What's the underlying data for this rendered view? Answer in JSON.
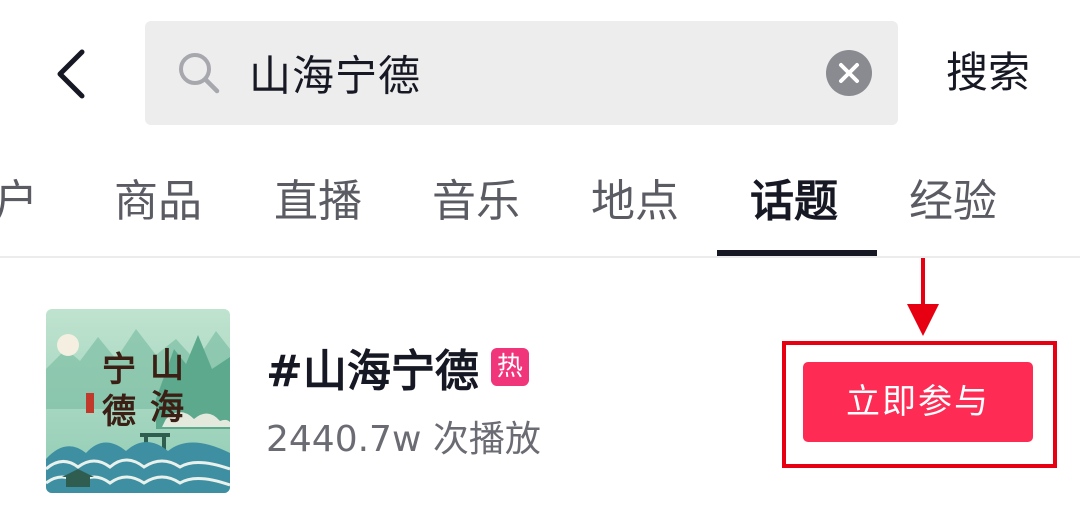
{
  "header": {
    "back_icon": "chevron-left-icon",
    "search": {
      "icon": "search-icon",
      "value": "山海宁德",
      "clear_icon": "clear-circle-icon"
    },
    "submit_label": "搜索"
  },
  "tabs": {
    "items": [
      {
        "label": "户",
        "active": false
      },
      {
        "label": "商品",
        "active": false
      },
      {
        "label": "直播",
        "active": false
      },
      {
        "label": "音乐",
        "active": false
      },
      {
        "label": "地点",
        "active": false
      },
      {
        "label": "话题",
        "active": true
      },
      {
        "label": "经验",
        "active": false
      }
    ]
  },
  "topic": {
    "cover_text": [
      "宁",
      "山",
      "德",
      "海"
    ],
    "title": "#山海宁德",
    "hot_badge": "热",
    "plays": "2440.7w 次播放",
    "join_label": "立即参与"
  },
  "colors": {
    "accent": "#fe2c55",
    "hot_badge": "#f0357a",
    "annotation": "#e60012",
    "active_tab": "#161823",
    "inactive_tab": "#5a5b63"
  }
}
